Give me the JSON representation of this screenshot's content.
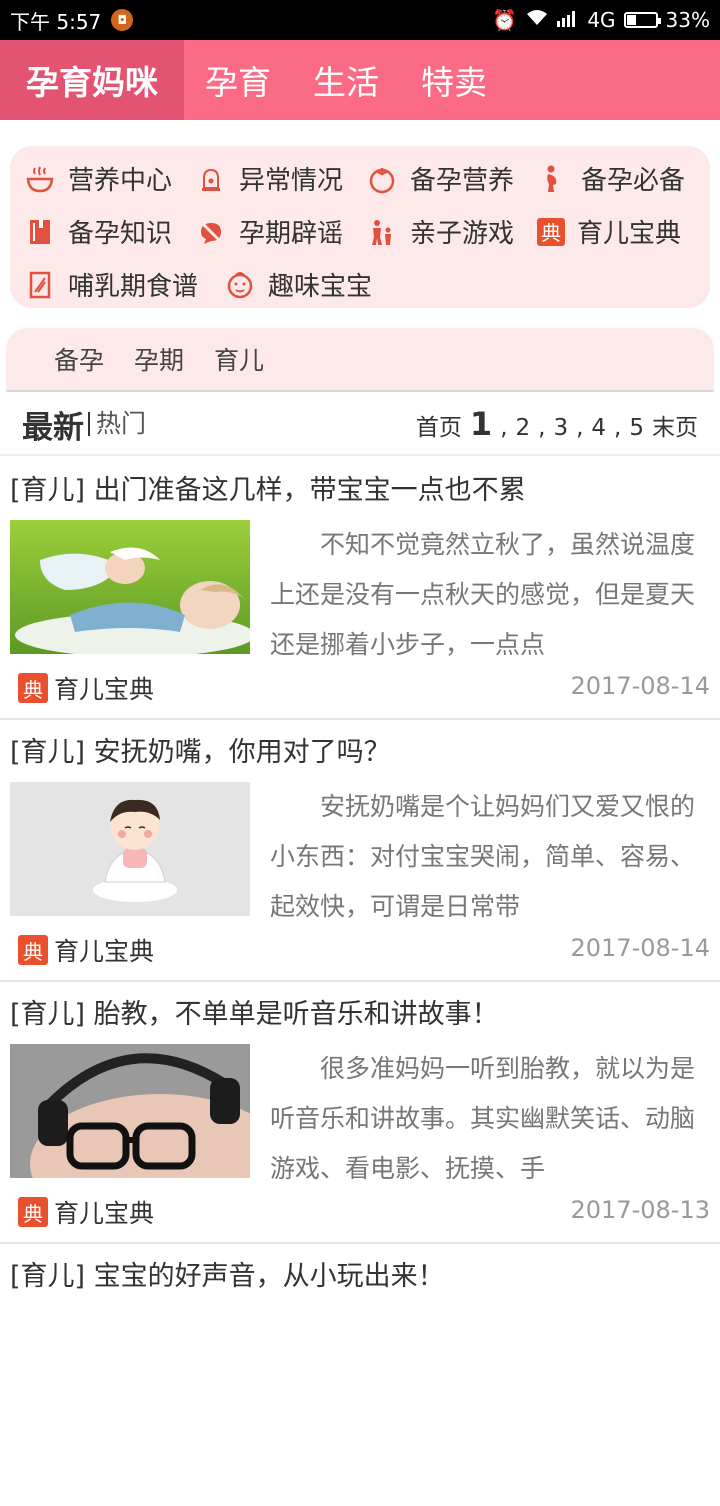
{
  "status_bar": {
    "time": "下午 5:57",
    "network": "4G",
    "battery": "33%",
    "battery_level": 0.33
  },
  "topnav": {
    "brand": "孕育妈咪",
    "tabs": [
      "孕育",
      "生活",
      "特卖"
    ]
  },
  "categories": [
    {
      "label": "营养中心",
      "icon": "bowl-icon"
    },
    {
      "label": "异常情况",
      "icon": "alarm-icon"
    },
    {
      "label": "备孕营养",
      "icon": "tomato-icon"
    },
    {
      "label": "备孕必备",
      "icon": "pregnant-icon"
    },
    {
      "label": "备孕知识",
      "icon": "book-icon"
    },
    {
      "label": "孕期辟谣",
      "icon": "no-rumor-icon"
    },
    {
      "label": "亲子游戏",
      "icon": "family-icon"
    },
    {
      "label": "育儿宝典",
      "icon": "dian-icon"
    },
    {
      "label": "哺乳期食谱",
      "icon": "recipe-icon"
    },
    {
      "label": "趣味宝宝",
      "icon": "baby-face-icon"
    }
  ],
  "subtabs": [
    "备孕",
    "孕期",
    "育儿"
  ],
  "sort": {
    "latest": "最新",
    "hot": "热门"
  },
  "pager": {
    "first": "首页",
    "current": "1",
    "pages": [
      "2",
      "3",
      "4",
      "5"
    ],
    "last": "末页"
  },
  "articles": [
    {
      "title": "[育儿] 出门准备这几样，带宝宝一点也不累",
      "summary": "不知不觉竟然立秋了，虽然说温度上还是没有一点秋天的感觉，但是夏天还是挪着小步子，一点点",
      "source": "育儿宝典",
      "badge": "典",
      "date": "2017-08-14"
    },
    {
      "title": "[育儿]  安抚奶嘴，你用对了吗？",
      "summary": "安抚奶嘴是个让妈妈们又爱又恨的小东西：对付宝宝哭闹，简单、容易、起效快，可谓是日常带",
      "source": "育儿宝典",
      "badge": "典",
      "date": "2017-08-14"
    },
    {
      "title": "[育儿] 胎教，不单单是听音乐和讲故事！",
      "summary": "很多准妈妈一听到胎教，就以为是听音乐和讲故事。其实幽默笑话、动脑游戏、看电影、抚摸、手",
      "source": "育儿宝典",
      "badge": "典",
      "date": "2017-08-13"
    },
    {
      "title": "[育儿] 宝宝的好声音，从小玩出来！",
      "summary": "",
      "source": "",
      "badge": "",
      "date": ""
    }
  ],
  "colors": {
    "primary": "#fc6b86",
    "brand_bg": "#e35473",
    "card_bg": "#fde8ea",
    "badge": "#e8502e"
  }
}
